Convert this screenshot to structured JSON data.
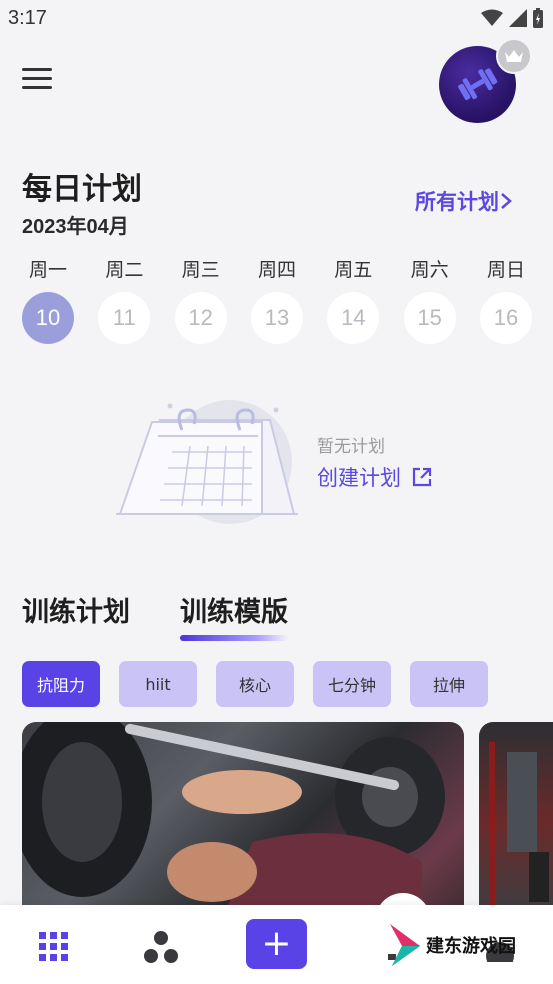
{
  "status": {
    "time": "3:17"
  },
  "header": {
    "title": "每日计划",
    "month": "2023年04月",
    "all_plans_label": "所有计划"
  },
  "week": [
    {
      "weekday": "周一",
      "date": "10",
      "active": true
    },
    {
      "weekday": "周二",
      "date": "11"
    },
    {
      "weekday": "周三",
      "date": "12"
    },
    {
      "weekday": "周四",
      "date": "13"
    },
    {
      "weekday": "周五",
      "date": "14"
    },
    {
      "weekday": "周六",
      "date": "15"
    },
    {
      "weekday": "周日",
      "date": "16"
    }
  ],
  "empty_state": {
    "text": "暂无计划",
    "create_label": "创建计划"
  },
  "tabs": [
    {
      "label": "训练计划"
    },
    {
      "label": "训练模版",
      "active": true
    }
  ],
  "chips": [
    {
      "label": "抗阻力",
      "active": true
    },
    {
      "label": "hiit"
    },
    {
      "label": "核心"
    },
    {
      "label": "七分钟"
    },
    {
      "label": "拉伸"
    }
  ],
  "watermark": {
    "text": "建东游戏园"
  },
  "colors": {
    "accent": "#5a43e6",
    "accent_text": "#5a48e0",
    "active_day": "#9a9fdc",
    "chip_bg": "#c9c3f6"
  },
  "icons": [
    "menu-icon",
    "crown-icon",
    "chevron-right-icon",
    "external-link-icon",
    "grid-icon",
    "dots-icon",
    "plus-icon"
  ]
}
